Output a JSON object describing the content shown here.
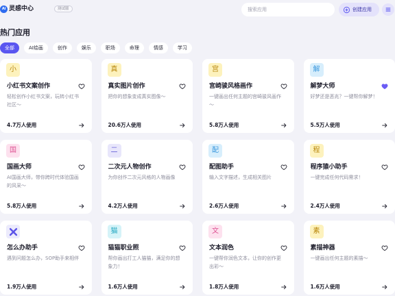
{
  "header": {
    "logo_text": "Ai",
    "title": "灵感中心",
    "badge": "测试版",
    "search_placeholder": "搜索应用",
    "create_button_label": "创建应用"
  },
  "section": {
    "title": "热门应用"
  },
  "tabs": [
    {
      "label": "全部",
      "selected": true
    },
    {
      "label": "AI绘画",
      "selected": false
    },
    {
      "label": "创作",
      "selected": false
    },
    {
      "label": "娱乐",
      "selected": false
    },
    {
      "label": "职场",
      "selected": false
    },
    {
      "label": "命理",
      "selected": false
    },
    {
      "label": "情感",
      "selected": false
    },
    {
      "label": "学习",
      "selected": false
    }
  ],
  "apps": [
    {
      "icon_char": "小",
      "icon_bg": "#fdf2bd",
      "icon_color": "#b8860b",
      "title": "小红书文案创作",
      "description": "轻松创作小红书文案，玩转小红书社区～",
      "usage": "4.7万人使用",
      "favorited": false
    },
    {
      "icon_char": "真",
      "icon_bg": "#fdf2bd",
      "icon_color": "#b8860b",
      "title": "真实图片创作",
      "description": "把你的想象变成真实图像～",
      "usage": "20.6万人使用",
      "favorited": false
    },
    {
      "icon_char": "宫",
      "icon_bg": "#fdf2bd",
      "icon_color": "#b8860b",
      "title": "宫崎骏风格画作",
      "description": "一键画出任何主题的宫崎骏风画作～",
      "usage": "5.8万人使用",
      "favorited": false
    },
    {
      "icon_char": "解",
      "icon_bg": "#d7eefc",
      "icon_color": "#3a97dd",
      "title": "解梦大师",
      "description": "好梦还是恶兆？一键帮你解梦！",
      "usage": "5.5万人使用",
      "favorited": true
    },
    {
      "icon_char": "国",
      "icon_bg": "#fde1ee",
      "icon_color": "#de5594",
      "title": "国画大师",
      "description": "AI国画大师，带你跨时代体验国画的风采～",
      "usage": "5.8万人使用",
      "favorited": false
    },
    {
      "icon_char": "二",
      "icon_bg": "#e8e6fb",
      "icon_color": "#6a62d8",
      "title": "二次元人物创作",
      "description": "为你创作二次元风格的人物画像",
      "usage": "4.2万人使用",
      "favorited": false
    },
    {
      "icon_char": "配",
      "icon_bg": "#d7eefc",
      "icon_color": "#3a97dd",
      "title": "配图助手",
      "description": "输入文字描述，生成相关图片",
      "usage": "2.6万人使用",
      "favorited": false
    },
    {
      "icon_char": "程",
      "icon_bg": "#fdf2bd",
      "icon_color": "#b8860b",
      "title": "程序猿小助手",
      "description": "一键完成任何代码需求！",
      "usage": "2.4万人使用",
      "favorited": false
    },
    {
      "icon": "x-logo-icon",
      "icon_bg": "#ecebfc",
      "icon_color": "#5b52e8",
      "title": "怎么办助手",
      "description": "遇到问题怎么办，SOP助手来相伴",
      "usage": "1.9万人使用",
      "favorited": false
    },
    {
      "icon_char": "猫",
      "icon_bg": "#d5f3f8",
      "icon_color": "#20a6c0",
      "title": "猫猫职业照",
      "description": "帮你画出打工人猫猫，满足你的想象力！",
      "usage": "1.6万人使用",
      "favorited": false
    },
    {
      "icon_char": "文",
      "icon_bg": "#fde1ee",
      "icon_color": "#de5594",
      "title": "文本润色",
      "description": "一键帮你润色文本，让你的创作更出彩～",
      "usage": "1.8万人使用",
      "favorited": false
    },
    {
      "icon_char": "素",
      "icon_bg": "#fdf2bd",
      "icon_color": "#b8860b",
      "title": "素描神器",
      "description": "一键画出任何主题的素描～",
      "usage": "1.6万人使用",
      "favorited": false
    }
  ],
  "icons": {
    "create": "plus-circle-icon",
    "menu": "menu-icon",
    "favorite": "heart-icon",
    "open": "arrow-right-icon"
  },
  "colors": {
    "accent": "#5a56f0",
    "page_background": "#f2f2f8",
    "card_background": "#ffffff",
    "favorite": "#6b5cf5",
    "soft_accent": "#e4e2fb"
  }
}
